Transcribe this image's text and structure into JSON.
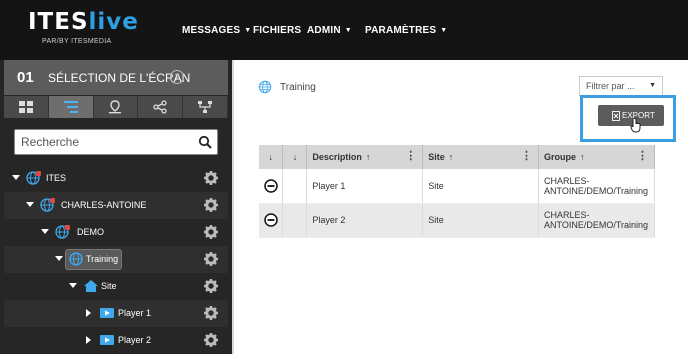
{
  "brand": {
    "name": "ITES",
    "name_accent": "live",
    "tagline": "PAR/BY ITESMEDIA"
  },
  "nav": {
    "items": [
      {
        "label": "MESSAGES",
        "dropdown": true
      },
      {
        "label": "FICHIERS",
        "dropdown": false
      },
      {
        "label": "ADMIN",
        "dropdown": true
      },
      {
        "label": "PARAMÈTRES",
        "dropdown": true
      }
    ]
  },
  "sidebar": {
    "step_number": "01",
    "title": "SÉLECTION DE L'ÉCRAN",
    "tabs": [
      {
        "icon": "grid-icon",
        "active": false
      },
      {
        "icon": "tree-list-icon",
        "active": true
      },
      {
        "icon": "location-icon",
        "active": false
      },
      {
        "icon": "share-icon",
        "active": false
      },
      {
        "icon": "hierarchy-icon",
        "active": false
      }
    ],
    "search": {
      "placeholder": "Recherche",
      "value": ""
    },
    "tree": [
      {
        "label": "ITES",
        "icon": "globe-lock-icon"
      },
      {
        "label": "CHARLES-ANTOINE",
        "icon": "globe-lock-icon"
      },
      {
        "label": "DEMO",
        "icon": "globe-lock-icon"
      },
      {
        "label": "Training",
        "icon": "globe-icon",
        "selected": true
      },
      {
        "label": "Site",
        "icon": "home-icon"
      },
      {
        "label": "Player 1",
        "icon": "player-icon"
      },
      {
        "label": "Player 2",
        "icon": "player-icon"
      }
    ]
  },
  "main": {
    "breadcrumb": "Training",
    "filter": {
      "placeholder": "Filtrer par ..."
    },
    "export_label": "EXPORT",
    "table": {
      "columns": [
        "Description",
        "Site",
        "Groupe"
      ],
      "rows": [
        {
          "description": "Player 1",
          "site": "Site",
          "groupe": "CHARLES-ANTOINE/DEMO/Training"
        },
        {
          "description": "Player 2",
          "site": "Site",
          "groupe": "CHARLES-ANTOINE/DEMO/Training"
        }
      ]
    }
  },
  "colors": {
    "accent": "#2e9fe0",
    "topbar": "#141414",
    "sidebar": "#262626"
  }
}
